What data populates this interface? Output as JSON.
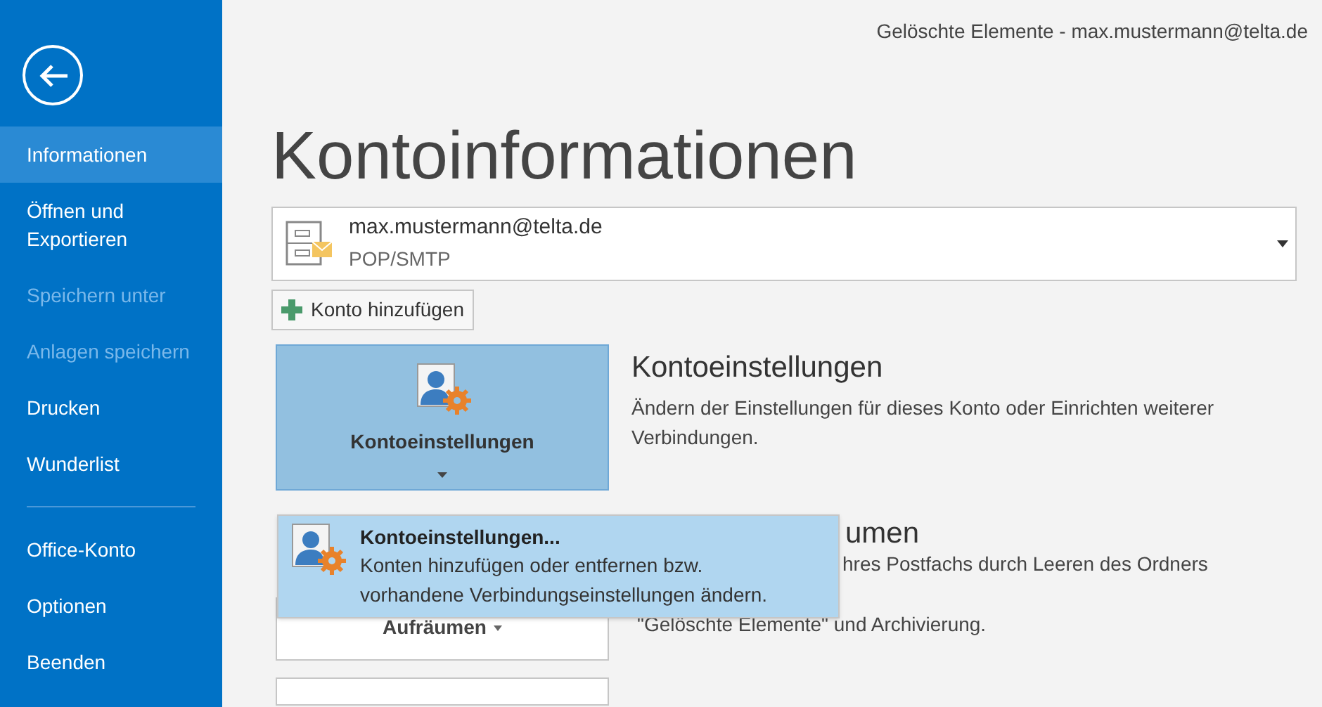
{
  "header": {
    "title": "Gelöschte Elemente - max.mustermann@telta.de"
  },
  "sidebar": {
    "items": [
      {
        "kind": "item",
        "label": "Informationen",
        "selected": true,
        "disabled": false
      },
      {
        "kind": "item",
        "label": "Öffnen und Exportieren",
        "selected": false,
        "disabled": false
      },
      {
        "kind": "item",
        "label": "Speichern unter",
        "selected": false,
        "disabled": true
      },
      {
        "kind": "item",
        "label": "Anlagen speichern",
        "selected": false,
        "disabled": true
      },
      {
        "kind": "item",
        "label": "Drucken",
        "selected": false,
        "disabled": false
      },
      {
        "kind": "item",
        "label": "Wunderlist",
        "selected": false,
        "disabled": false
      },
      {
        "kind": "divider"
      },
      {
        "kind": "item",
        "label": "Office-Konto",
        "selected": false,
        "disabled": false
      },
      {
        "kind": "item",
        "label": "Optionen",
        "selected": false,
        "disabled": false
      },
      {
        "kind": "item",
        "label": "Beenden",
        "selected": false,
        "disabled": false
      }
    ]
  },
  "page_title": "Kontoinformationen",
  "account": {
    "address": "max.mustermann@telta.de",
    "type": "POP/SMTP"
  },
  "add_account_button": "Konto hinzufügen",
  "account_settings": {
    "button": "Kontoeinstellungen",
    "expanded": true,
    "title": "Kontoeinstellungen",
    "description": "Ändern der Einstellungen für dieses Konto oder Einrichten weiterer Verbindungen."
  },
  "cleanup": {
    "button": "Aufräumen",
    "title": "umen",
    "description_lines": [
      "hres Postfachs durch Leeren des Ordners",
      "\"Gelöschte Elemente\" und Archivierung."
    ]
  },
  "dropdown_menu": {
    "items": [
      {
        "title": "Kontoeinstellungen...",
        "description": "Konten hinzufügen oder entfernen bzw. vorhandene Verbindungseinstellungen ändern."
      }
    ]
  }
}
